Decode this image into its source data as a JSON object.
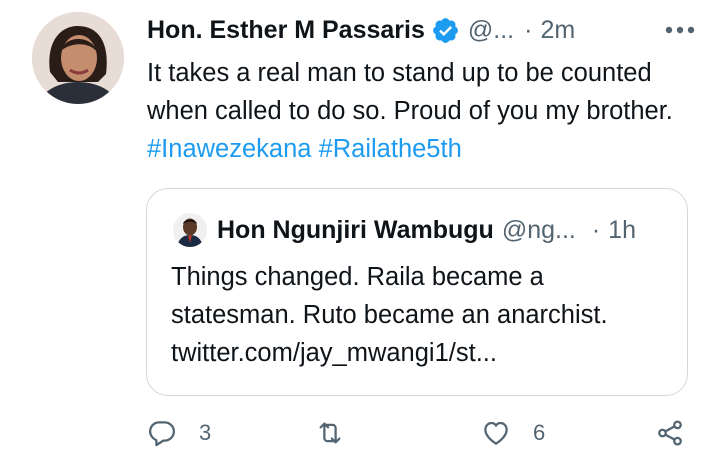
{
  "tweet": {
    "author_name": "Hon. Esther M Passaris",
    "handle": "@...",
    "separator": "·",
    "time": "2m",
    "text_plain": "It takes a real man to stand up to be counted when called to do so. Proud of you my brother.",
    "hashtags": [
      "#Inawezekana",
      "#Railathe5th"
    ],
    "avatar_icon": "profile-photo",
    "verified_icon": "verified-badge",
    "more_icon": "more-options-icon"
  },
  "quoted_tweet": {
    "author_name": "Hon Ngunjiri Wambugu",
    "handle": "@ng...",
    "separator": "·",
    "time": "1h",
    "line1": "Things changed. Raila became a",
    "line2": "statesman. Ruto became an anarchist.",
    "line3": "twitter.com/jay_mwangi1/st...",
    "avatar_icon": "profile-photo"
  },
  "actions": {
    "reply_count": "3",
    "retweet_count": "",
    "like_count": "6",
    "reply_icon": "reply-icon",
    "retweet_icon": "retweet-icon",
    "like_icon": "heart-icon",
    "share_icon": "share-icon"
  },
  "colors": {
    "link": "#1d9bf0",
    "secondary_text": "#536471",
    "border": "#cfd9de",
    "verified": "#1d9bf0"
  }
}
